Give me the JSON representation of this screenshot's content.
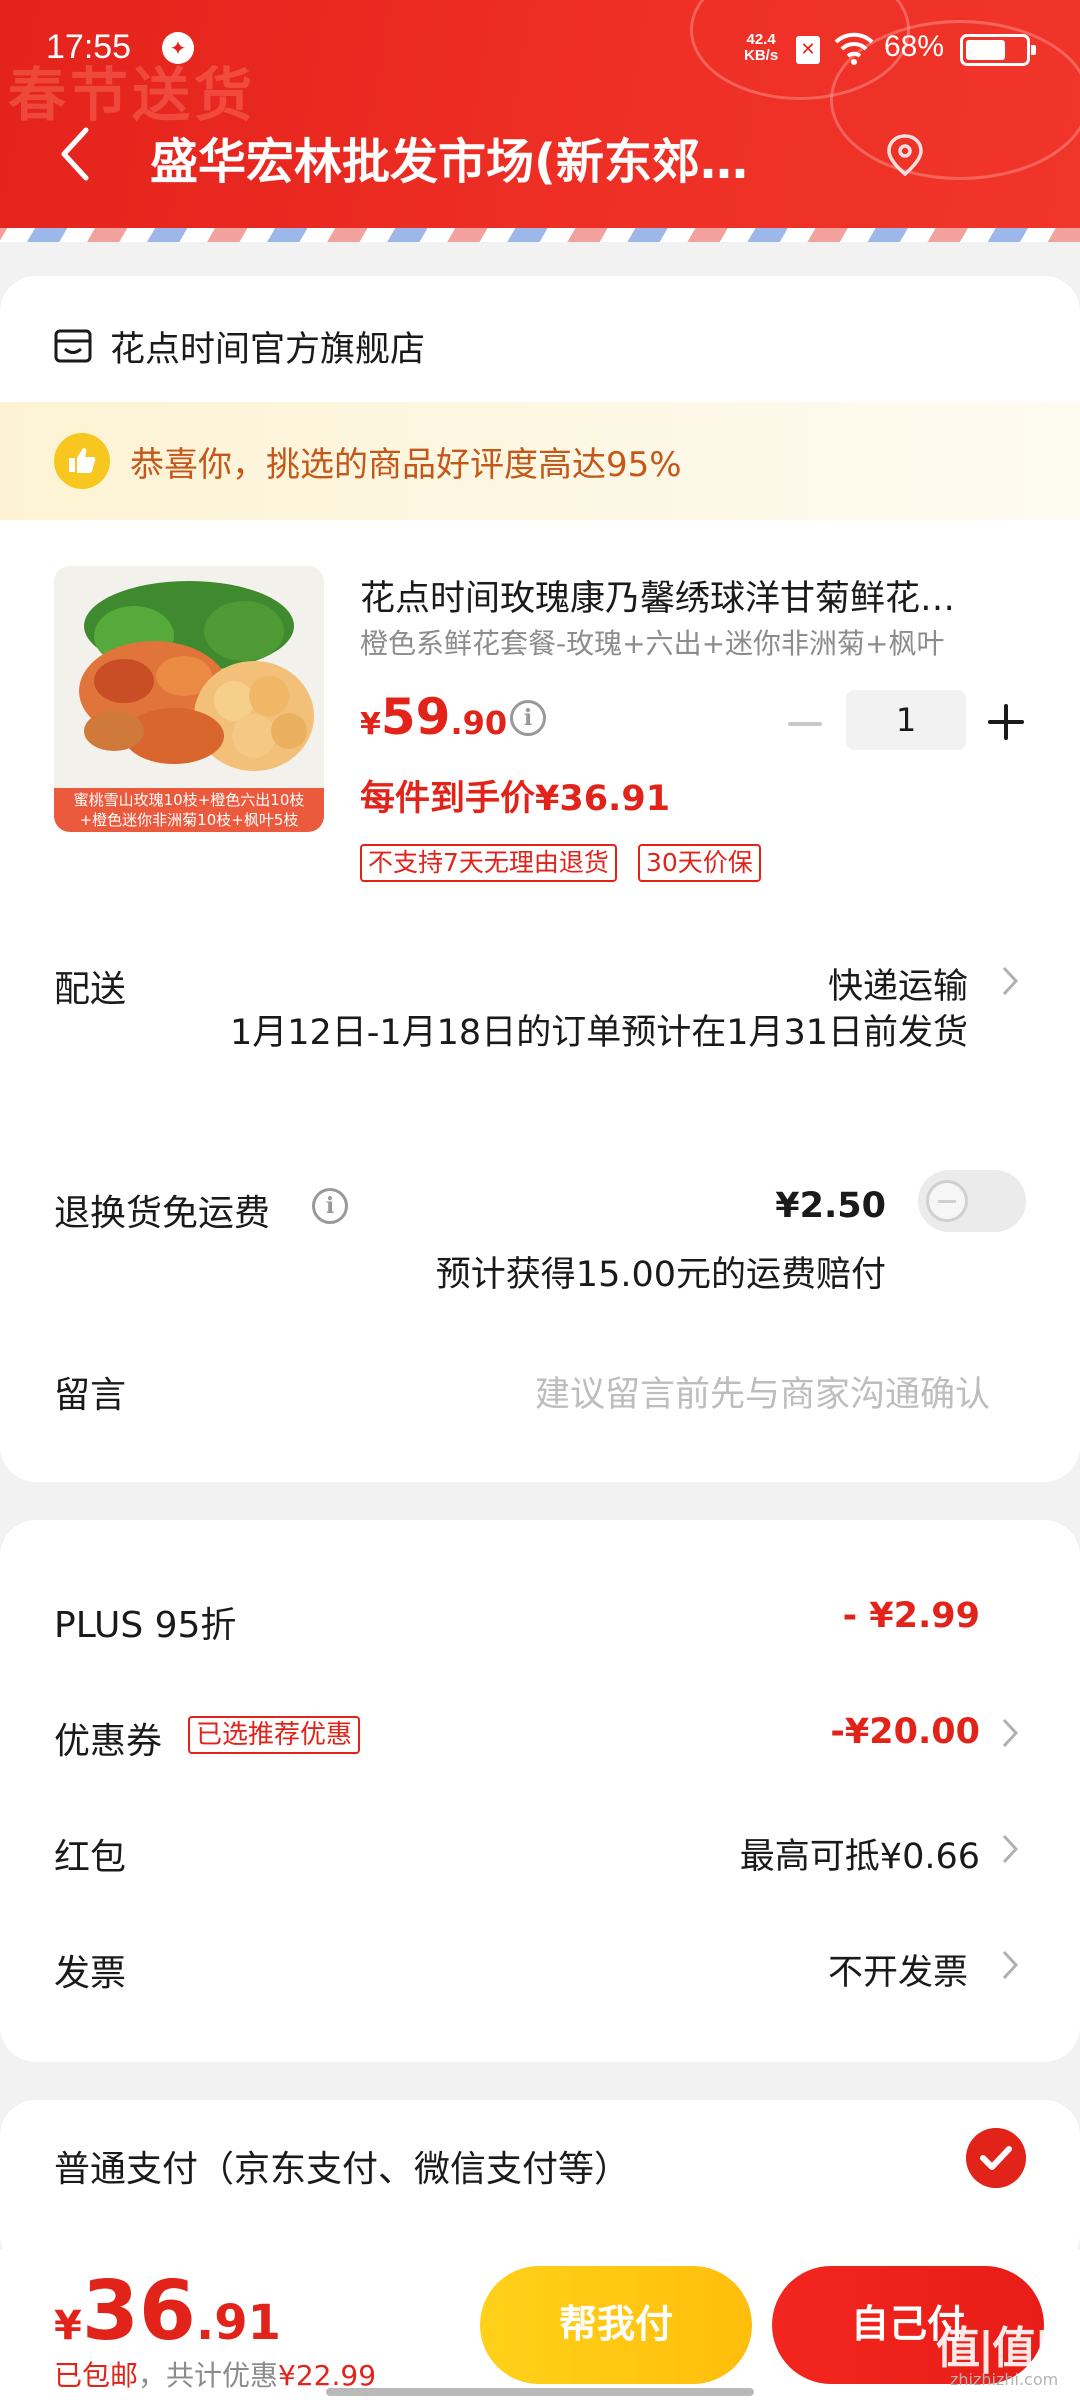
{
  "status_bar": {
    "time": "17:55",
    "speed_value": "42.4",
    "speed_unit": "KB/s",
    "battery": "68%",
    "battery_level": 0.68,
    "icons": [
      "app-notification-icon",
      "sim-card-icon",
      "wifi-icon",
      "battery-icon"
    ]
  },
  "nav": {
    "title": "盛华宏林批发市场(新东郊…",
    "back_icon": "chevron-left-icon",
    "location_icon": "location-pin-icon",
    "banner_text": "春节送货"
  },
  "store": {
    "name": "花点时间官方旗舰店",
    "praise": "恭喜你，挑选的商品好评度高达95%"
  },
  "product": {
    "title": "花点时间玫瑰康乃馨绣球洋甘菊鲜花…",
    "spec": "橙色系鲜花套餐-玫瑰+六出+迷你非洲菊+枫叶",
    "price_symbol": "¥",
    "price_int": "59",
    "price_dec": ".90",
    "quantity": "1",
    "final_price": "每件到手价¥36.91",
    "image_caption_1": "蜜桃雪山玫瑰10枝+橙色六出10枝",
    "image_caption_2": "+橙色迷你非洲菊10枝+枫叶5枝",
    "tags": [
      "不支持7天无理由退货",
      "30天价保"
    ]
  },
  "shipping": {
    "label": "配送",
    "value": "快递运输",
    "note": "1月12日-1月18日的订单预计在1月31日前发货"
  },
  "return_shipping": {
    "label": "退换货免运费",
    "price": "¥2.50",
    "sub": "预计获得15.00元的运费赔付",
    "enabled": false
  },
  "note": {
    "label": "留言",
    "placeholder": "建议留言前先与商家沟通确认"
  },
  "discounts": {
    "plus_label": "PLUS 95折",
    "plus_value": "- ¥2.99",
    "coupon_label": "优惠券",
    "coupon_tag": "已选推荐优惠",
    "coupon_value": "-¥20.00",
    "redpacket_label": "红包",
    "redpacket_value": "最高可抵¥0.66",
    "invoice_label": "发票",
    "invoice_value": "不开发票"
  },
  "payment": {
    "label": "普通支付（京东支付、微信支付等）",
    "selected": true
  },
  "bottom": {
    "total_symbol": "¥",
    "total_int": "36",
    "total_dec": ".91",
    "free_shipping": "已包邮",
    "discount_text": "，共计优惠",
    "discount_amount": "¥22.99",
    "help_pay": "帮我付",
    "self_pay": "自己付",
    "watermark": "值|值|值",
    "watermark_sub": "zhizhizhi.com"
  },
  "colors": {
    "brand_red": "#e2231a",
    "header_red": "#e4231c",
    "help_yellow": "#ffc515",
    "praise_text": "#c4581a"
  }
}
